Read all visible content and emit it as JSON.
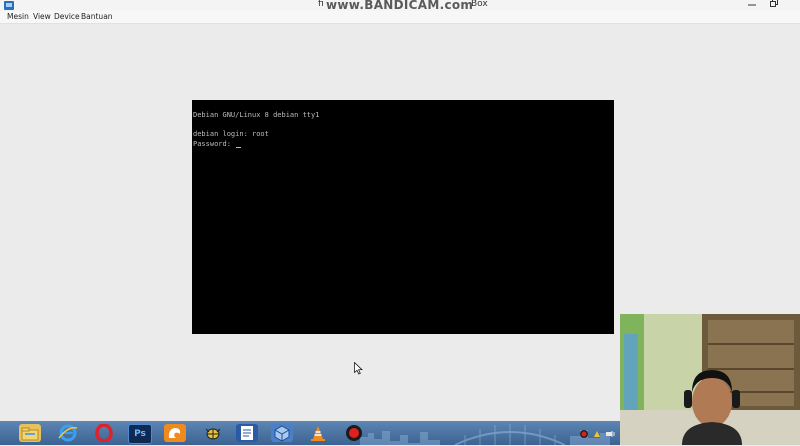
{
  "window": {
    "title_left": "fi",
    "title_right": "Box",
    "watermark": "www.BANDICAM.com"
  },
  "menu": {
    "items": [
      "Mesin",
      "View",
      "Device",
      "Bantuan"
    ]
  },
  "console": {
    "lines": [
      "Debian GNU/Linux 8 debian tty1",
      "",
      "debian login: root",
      "Password: "
    ]
  },
  "colors": {
    "console_bg": "#000000",
    "console_text": "#bdbdbd",
    "taskbar": "#4a72a3",
    "workarea": "#ebebeb"
  },
  "taskbar": {
    "icons": [
      "file-explorer-icon",
      "internet-explorer-icon",
      "opera-icon",
      "photoshop-icon",
      "uc-browser-icon",
      "bug-app-icon",
      "word-icon",
      "virtualbox-icon",
      "vlc-icon",
      "record-icon"
    ],
    "photoshop_label": "Ps"
  }
}
